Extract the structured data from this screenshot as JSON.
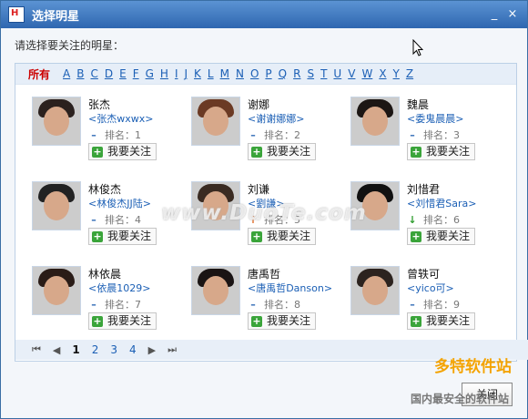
{
  "window": {
    "title": "选择明星",
    "icon_text": "H",
    "minimize": "_",
    "close": "×"
  },
  "prompt": "请选择要关注的明星：",
  "letters": [
    "所有",
    "A",
    "B",
    "C",
    "D",
    "E",
    "F",
    "G",
    "H",
    "I",
    "J",
    "K",
    "L",
    "M",
    "N",
    "O",
    "P",
    "Q",
    "R",
    "S",
    "T",
    "U",
    "V",
    "W",
    "X",
    "Y",
    "Z"
  ],
  "stars": [
    {
      "name": "张杰",
      "alias": "<张杰wxwx>",
      "rank": "排名：1",
      "trend": "flat",
      "follow": "我要关注"
    },
    {
      "name": "谢娜",
      "alias": "<谢谢娜娜>",
      "rank": "排名：2",
      "trend": "flat",
      "follow": "我要关注"
    },
    {
      "name": "魏晨",
      "alias": "<委鬼晨晨>",
      "rank": "排名：3",
      "trend": "flat",
      "follow": "我要关注"
    },
    {
      "name": "林俊杰",
      "alias": "<林俊杰JJ陆>",
      "rank": "排名：4",
      "trend": "flat",
      "follow": "我要关注"
    },
    {
      "name": "刘谦",
      "alias": "<劉謙>",
      "rank": "排名：5",
      "trend": "up",
      "follow": "我要关注"
    },
    {
      "name": "刘惜君",
      "alias": "<刘惜君Sara>",
      "rank": "排名：6",
      "trend": "down",
      "follow": "我要关注"
    },
    {
      "name": "林依晨",
      "alias": "<依晨1029>",
      "rank": "排名：7",
      "trend": "flat",
      "follow": "我要关注"
    },
    {
      "name": "唐禹哲",
      "alias": "<唐禹哲Danson>",
      "rank": "排名：8",
      "trend": "flat",
      "follow": "我要关注"
    },
    {
      "name": "曾轶可",
      "alias": "<yico可>",
      "rank": "排名：9",
      "trend": "flat",
      "follow": "我要关注"
    }
  ],
  "pager": {
    "first": "⏮",
    "prev": "◀",
    "pages": [
      "1",
      "2",
      "3",
      "4"
    ],
    "current": "1",
    "next": "▶",
    "last": "⏭"
  },
  "close_button": "关闭",
  "watermarks": [
    "www.DuoTe.com",
    "多特软件站",
    "国内最安全的软件站"
  ]
}
